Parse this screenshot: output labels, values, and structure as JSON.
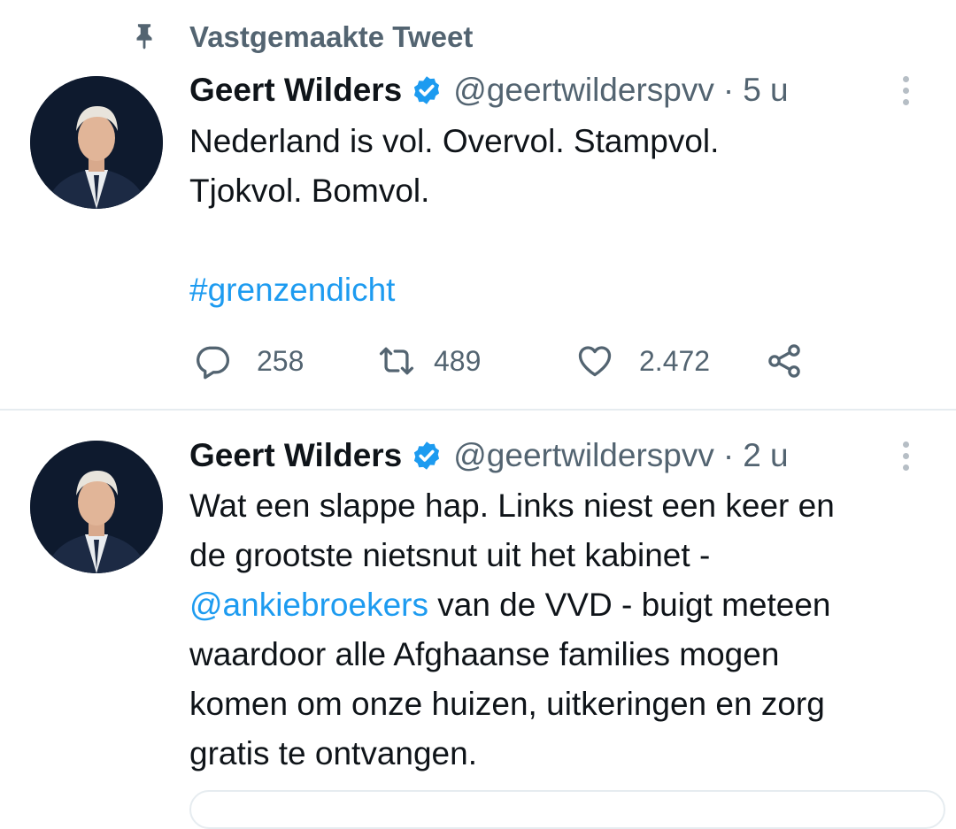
{
  "pinned": {
    "label": "Vastgemaakte Tweet",
    "icon": "pin-icon"
  },
  "tweets": [
    {
      "name": "Geert Wilders",
      "handle": "@geertwilderspvv",
      "separator": "·",
      "time": "5 u",
      "text_lines": [
        "Nederland is vol. Overvol. Stampvol.",
        "Tjokvol. Bomvol.",
        "",
        "#grenzendicht"
      ],
      "actions": {
        "replies": "258",
        "retweets": "489",
        "likes": "2.472"
      }
    },
    {
      "name": "Geert Wilders",
      "handle": "@geertwilderspvv",
      "separator": "·",
      "time": "2 u",
      "text": {
        "line1": "Wat een slappe hap. Links niest een keer en",
        "line2": "de grootste nietsnut uit het kabinet -",
        "mention": "@ankiebroekers",
        "line3_rest": " van de VVD - buigt meteen",
        "line4": "waardoor alle Afghaanse families mogen",
        "line5": "komen om onze huizen, uitkeringen en zorg",
        "line6": "gratis te ontvangen."
      }
    }
  ],
  "colors": {
    "accent": "#1d9bf0",
    "text": "#0f1419",
    "secondary": "#536471",
    "divider": "#e6ecf0"
  }
}
